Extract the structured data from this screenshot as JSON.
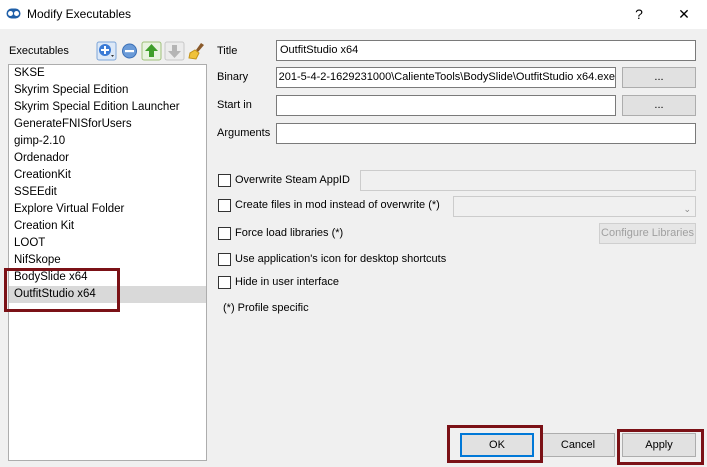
{
  "window": {
    "title": "Modify Executables",
    "help_label": "?",
    "close_label": "✕"
  },
  "sidebar": {
    "label": "Executables",
    "items": [
      "SKSE",
      "Skyrim Special Edition",
      "Skyrim Special Edition Launcher",
      "GenerateFNISforUsers",
      "gimp-2.10",
      "Ordenador",
      "CreationKit",
      "SSEEdit",
      "Explore Virtual Folder",
      "Creation Kit",
      "LOOT",
      "NifSkope",
      "BodySlide x64",
      "OutfitStudio x64"
    ],
    "selected": "OutfitStudio x64"
  },
  "form": {
    "title_label": "Title",
    "title_value": "OutfitStudio x64",
    "binary_label": "Binary",
    "binary_value": "201-5-4-2-1629231000\\CalienteTools\\BodySlide\\OutfitStudio x64.exe",
    "browse_label": "...",
    "start_in_label": "Start in",
    "start_in_value": "",
    "arguments_label": "Arguments",
    "arguments_value": ""
  },
  "options": {
    "overwrite_appid": "Overwrite Steam AppID",
    "create_files": "Create files in mod instead of overwrite (*)",
    "force_load": "Force load libraries (*)",
    "configure_libraries": "Configure Libraries",
    "use_icon": "Use application's icon for desktop shortcuts",
    "hide_ui": "Hide in user interface",
    "profile_specific": "(*) Profile specific"
  },
  "buttons": {
    "ok": "OK",
    "cancel": "Cancel",
    "apply": "Apply"
  },
  "colors": {
    "highlight": "#7b1116",
    "accent": "#0078d7"
  }
}
